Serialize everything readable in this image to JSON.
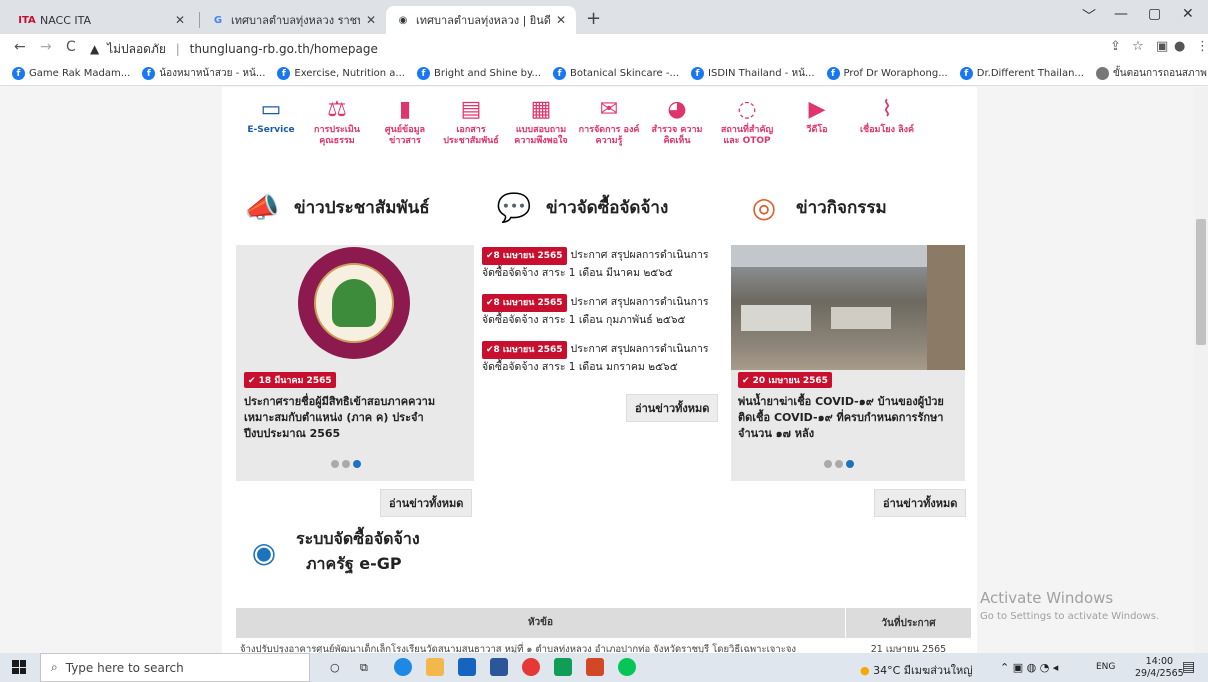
{
  "browser": {
    "tabs": [
      {
        "favicon": "ITA",
        "title": "NACC ITA"
      },
      {
        "favicon": "G",
        "title": "เทศบาลตำบลทุ่งหลวง ราชบุรี - Googl"
      },
      {
        "favicon": "globe-icon",
        "title": "เทศบาลตำบลทุ่งหลวง | ยินดีต้อนรับ"
      }
    ],
    "new_tab": "+",
    "window_controls": [
      "﹀",
      "—",
      "▢",
      "✕"
    ],
    "nav": {
      "back": "←",
      "forward": "→",
      "reload": "C"
    },
    "address": {
      "security_label": "ไม่ปลอดภัย",
      "url": "thungluang-rb.go.th/homepage"
    },
    "bookmarks": [
      "Game Rak Madam...",
      "น้องหมาหน้าสวย - หน้...",
      "Exercise, Nutrition a...",
      "Bright and Shine by...",
      "Botanical Skincare -...",
      "ISDIN Thailand - หน้...",
      "Prof Dr Woraphong...",
      "Dr.Different Thailan...",
      "ขั้นตอนการถอนสภาพ..."
    ]
  },
  "nav_icons": [
    {
      "label": "E-Service",
      "icon": "laptop-icon",
      "color": "#1e5aa8"
    },
    {
      "label": "การประเมิน คุณธรรม",
      "icon": "scale-icon",
      "color": "#e0356b"
    },
    {
      "label": "ศูนย์ข้อมูล ข่าวสาร",
      "icon": "bar-chart-icon",
      "color": "#e0356b"
    },
    {
      "label": "เอกสาร ประชาสัมพันธ์",
      "icon": "book-icon",
      "color": "#e0356b"
    },
    {
      "label": "แบบสอบถาม ความพึงพอใจ",
      "icon": "document-icon",
      "color": "#e0356b"
    },
    {
      "label": "การจัดการ องค์ความรู้",
      "icon": "envelope-icon",
      "color": "#e0356b"
    },
    {
      "label": "สำรวจ ความคิดเห็น",
      "icon": "pie-icon",
      "color": "#e0356b"
    },
    {
      "label": "สถานที่สำคัญ และ OTOP",
      "icon": "map-pin-icon",
      "color": "#e0356b"
    },
    {
      "label": "วีดีโอ",
      "icon": "play-icon",
      "color": "#e0356b"
    },
    {
      "label": "เชื่อมโยง ลิงค์",
      "icon": "link-icon",
      "color": "#e0356b"
    }
  ],
  "sections": {
    "pr": {
      "title": "ข่าวประชาสัมพันธ์",
      "badge": "✔ 18 มีนาคม 2565",
      "headline": "ประกาศรายชื่อผู้มีสิทธิเข้าสอบภาคความ เหมาะสมกับตำแหน่ง (ภาค ค) ประจำ ปีงบประมาณ 2565",
      "read_all": "อ่านข่าวทั้งหมด"
    },
    "procurement": {
      "title": "ข่าวจัดซื้อจัดจ้าง",
      "items": [
        {
          "badge": "✔8 เมษายน 2565",
          "text": "ประกาศ สรุปผลการดำเนินการจัดซื้อจัดจ้าง สาระ 1 เดือน มีนาคม ๒๕๖๕"
        },
        {
          "badge": "✔8 เมษายน 2565",
          "text": "ประกาศ สรุปผลการดำเนินการจัดซื้อจัดจ้าง สาระ 1 เดือน กุมภาพันธ์ ๒๕๖๕"
        },
        {
          "badge": "✔8 เมษายน 2565",
          "text": "ประกาศ สรุปผลการดำเนินการจัดซื้อจัดจ้าง สาระ 1 เดือน มกราคม ๒๕๖๕"
        }
      ],
      "read_all": "อ่านข่าวทั้งหมด"
    },
    "activity": {
      "title": "ข่าวกิจกรรม",
      "badge": "✔ 20 เมษายน 2565",
      "headline": "พ่นน้ำยาฆ่าเชื้อ COVID-๑๙ บ้านของผู้ป่วย ติดเชื้อ COVID-๑๙ ที่ครบกำหนดการรักษา จำนวน ๑๗ หลัง",
      "read_all": "อ่านข่าวทั้งหมด"
    },
    "egp": {
      "title_line1": "ระบบจัดซื้อจัดจ้าง",
      "title_line2": "ภาครัฐ e-GP",
      "columns": [
        "หัวข้อ",
        "วันที่ประกาศ"
      ],
      "rows": [
        {
          "topic": "จ้างปรับปรุงอาคารศูนย์พัฒนาเด็กเล็กโรงเรียนวัดสนามสนธาวาส หมู่ที่ ๑ ตำบลทุ่งหลวง อำเภอปากท่อ จังหวัดราชบุรี โดยวิธีเฉพาะเจาะจง",
          "date": "21 เมษายน 2565"
        }
      ]
    }
  },
  "activate_windows": {
    "line1": "Activate Windows",
    "line2": "Go to Settings to activate Windows."
  },
  "taskbar": {
    "search_placeholder": "Type here to search",
    "weather": "34°C มีเมฆส่วนใหญ่",
    "lang": "ENG",
    "time": "14:00",
    "date": "29/4/2565"
  }
}
